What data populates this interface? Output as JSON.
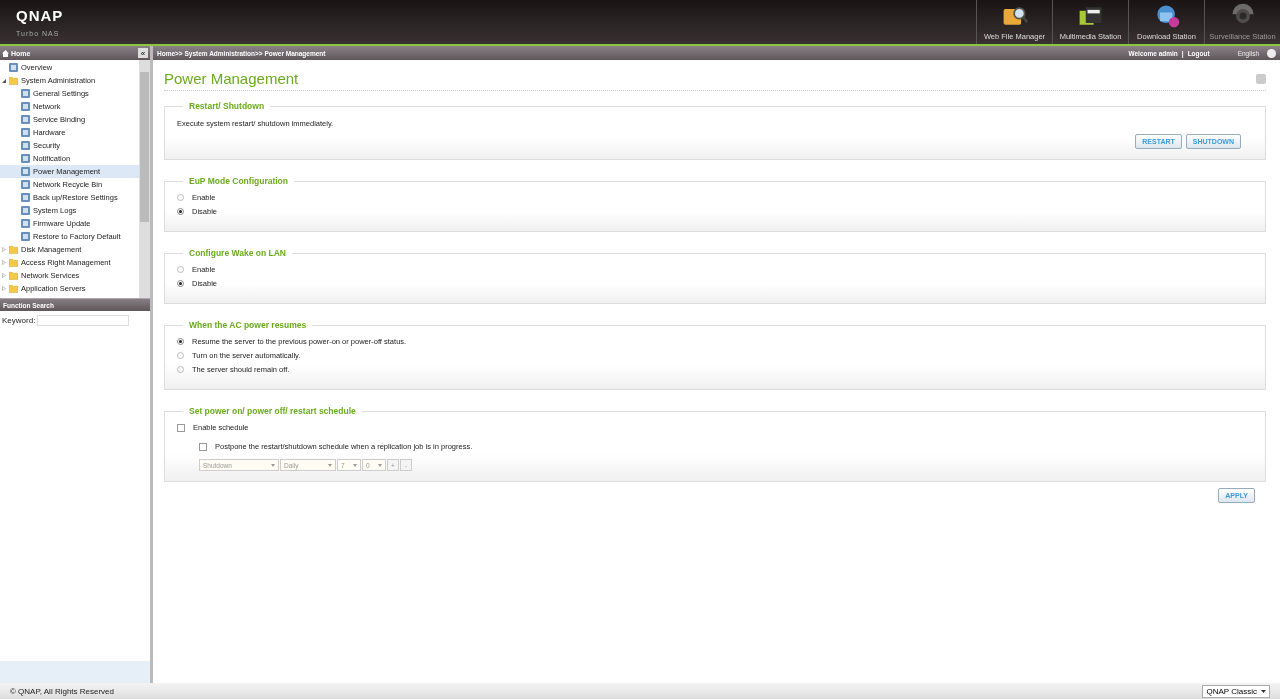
{
  "header": {
    "logo": "QNAP",
    "subtitle": "Turbo NAS",
    "apps": [
      {
        "label": "Web File Manager",
        "kind": "files",
        "disabled": false
      },
      {
        "label": "Multimedia Station",
        "kind": "media",
        "disabled": false
      },
      {
        "label": "Download Station",
        "kind": "download",
        "disabled": false
      },
      {
        "label": "Surveillance Station",
        "kind": "camera",
        "disabled": true
      }
    ]
  },
  "sidebar": {
    "title": "Home",
    "collapse": "«",
    "tree": [
      {
        "label": "Overview",
        "kind": "page",
        "selected": false
      },
      {
        "label": "System Administration",
        "kind": "folder",
        "expanded": true,
        "selected": false,
        "children": [
          {
            "label": "General Settings",
            "kind": "page",
            "selected": false
          },
          {
            "label": "Network",
            "kind": "page",
            "selected": false
          },
          {
            "label": "Service Binding",
            "kind": "page",
            "selected": false
          },
          {
            "label": "Hardware",
            "kind": "page",
            "selected": false
          },
          {
            "label": "Security",
            "kind": "page",
            "selected": false
          },
          {
            "label": "Notification",
            "kind": "page",
            "selected": false
          },
          {
            "label": "Power Management",
            "kind": "page",
            "selected": true
          },
          {
            "label": "Network Recycle Bin",
            "kind": "page",
            "selected": false
          },
          {
            "label": "Back up/Restore Settings",
            "kind": "page",
            "selected": false
          },
          {
            "label": "System Logs",
            "kind": "page",
            "selected": false
          },
          {
            "label": "Firmware Update",
            "kind": "page",
            "selected": false
          },
          {
            "label": "Restore to Factory Default",
            "kind": "page",
            "selected": false
          }
        ]
      },
      {
        "label": "Disk Management",
        "kind": "folder",
        "expanded": false,
        "selected": false
      },
      {
        "label": "Access Right Management",
        "kind": "folder",
        "expanded": false,
        "selected": false
      },
      {
        "label": "Network Services",
        "kind": "folder",
        "expanded": false,
        "selected": false
      },
      {
        "label": "Application Servers",
        "kind": "folder",
        "expanded": false,
        "selected": false
      }
    ],
    "search": {
      "title": "Function Search",
      "label": "Keyword:"
    }
  },
  "topbar": {
    "breadcrumb": "Home>> System Administration>> Power Management",
    "welcome": "Welcome admin",
    "logout": "Logout",
    "separator": "|",
    "language": "English"
  },
  "page": {
    "title": "Power Management",
    "sections": [
      {
        "kind": "action",
        "title": "Restart/ Shutdown",
        "text": "Execute system restart/ shutdown immediately.",
        "buttons": [
          "RESTART",
          "SHUTDOWN"
        ]
      },
      {
        "kind": "radios",
        "title": "EuP Mode Configuration",
        "options": [
          {
            "label": "Enable",
            "selected": false
          },
          {
            "label": "Disable",
            "selected": true
          }
        ]
      },
      {
        "kind": "radios",
        "title": "Configure Wake on LAN",
        "options": [
          {
            "label": "Enable",
            "selected": false
          },
          {
            "label": "Disable",
            "selected": true
          }
        ]
      },
      {
        "kind": "radios",
        "title": "When the AC power resumes",
        "options": [
          {
            "label": "Resume the server to the previous power-on or power-off status.",
            "selected": true
          },
          {
            "label": "Turn on the server automatically.",
            "selected": false
          },
          {
            "label": "The server should remain off.",
            "selected": false
          }
        ]
      },
      {
        "kind": "schedule",
        "title": "Set power on/ power off/ restart schedule",
        "enable": {
          "label": "Enable schedule",
          "checked": false
        },
        "postpone": {
          "label": "Postpone the restart/shutdown schedule when a replication job is in progress.",
          "checked": false
        },
        "selects": [
          "Shutdown",
          "Daily",
          "7",
          "0"
        ],
        "buttons": [
          "+",
          "-"
        ],
        "disabled": true
      }
    ],
    "apply": "APPLY"
  },
  "footer": {
    "copyright": "© QNAP, All Rights Reserved",
    "theme": "QNAP Classic"
  }
}
